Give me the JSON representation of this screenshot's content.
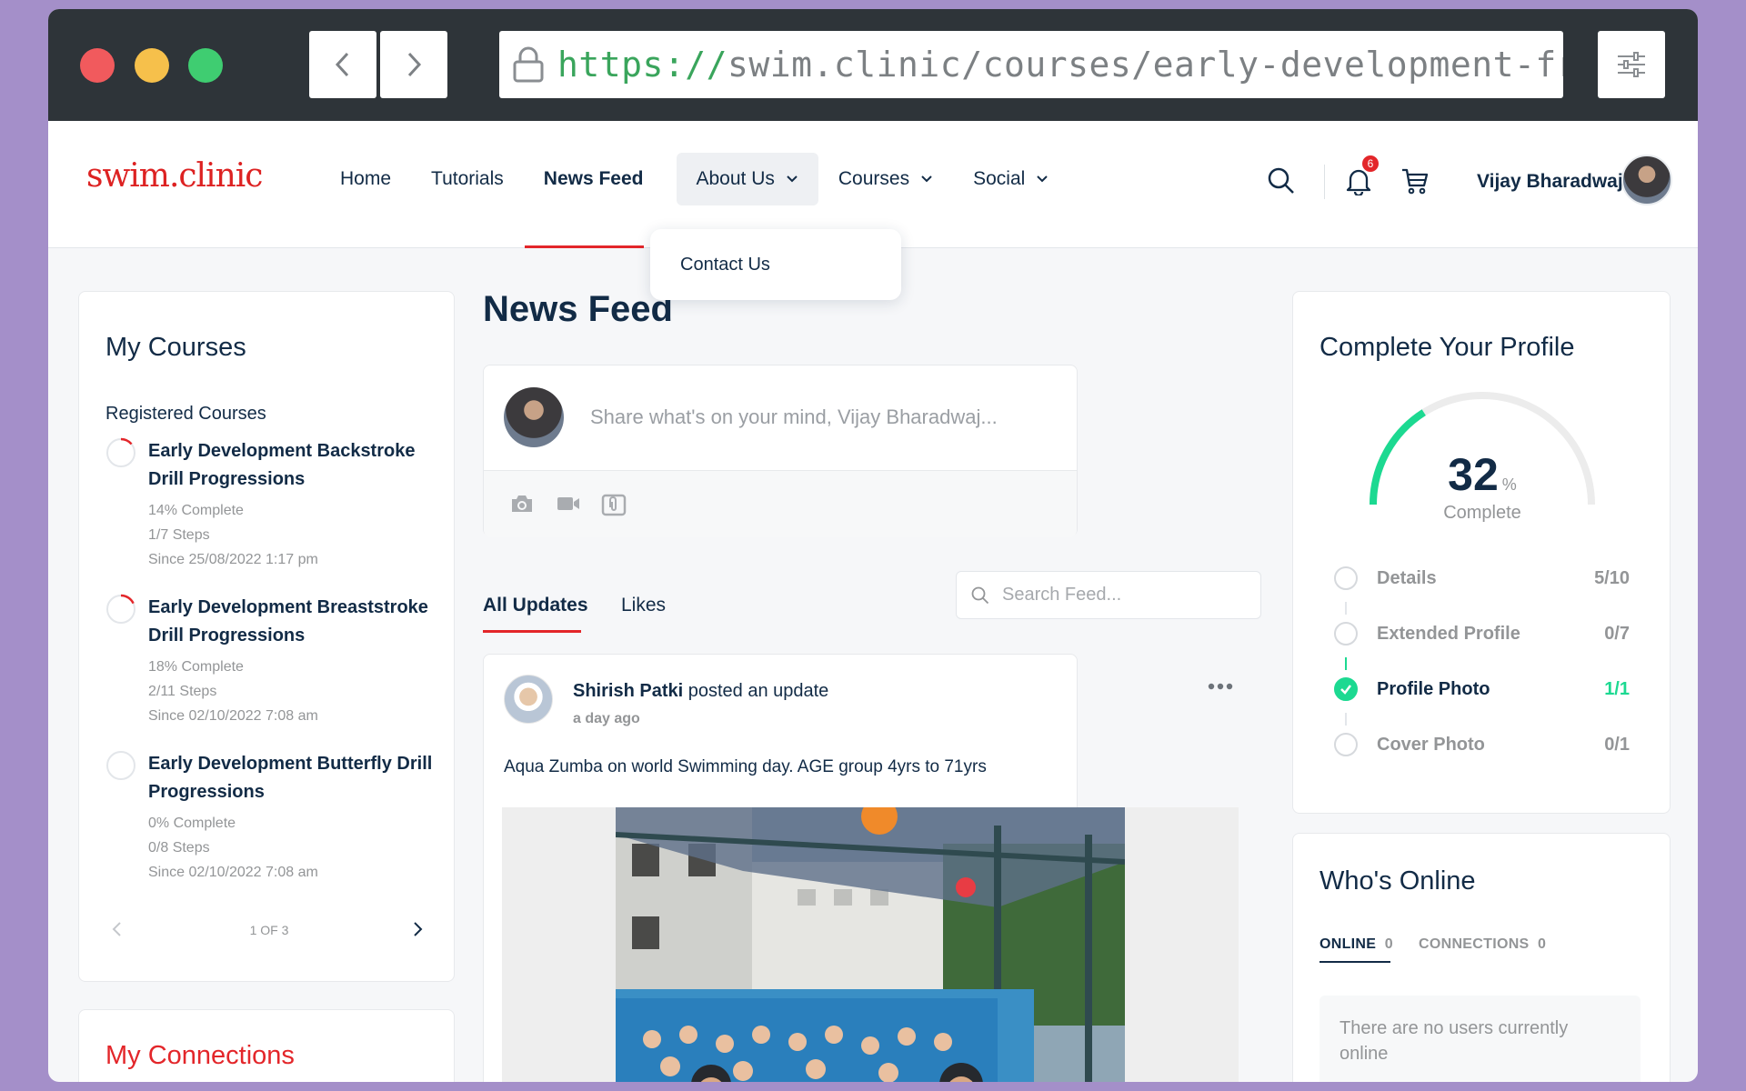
{
  "browser": {
    "url_protocol": "https://",
    "url_rest": "swim.clinic/courses/early-development-fre"
  },
  "site": {
    "logo": "swim.clinic",
    "nav": [
      {
        "label": "Home"
      },
      {
        "label": "Tutorials"
      },
      {
        "label": "News Feed"
      },
      {
        "label": "About Us"
      },
      {
        "label": "Courses"
      },
      {
        "label": "Social"
      }
    ],
    "dropdown_item": "Contact Us",
    "notification_count": "6",
    "user_name": "Vijay Bharadwaj"
  },
  "my_courses": {
    "title": "My Courses",
    "subtitle": "Registered Courses",
    "courses": [
      {
        "name": "Early Development Backstroke Drill Progressions",
        "percent": "14% Complete",
        "steps": "1/7 Steps",
        "since": "Since 25/08/2022 1:17 pm",
        "progress": 0.14
      },
      {
        "name": "Early Development Breaststroke Drill Progressions",
        "percent": "18% Complete",
        "steps": "2/11 Steps",
        "since": "Since 02/10/2022 7:08 am",
        "progress": 0.18
      },
      {
        "name": "Early Development Butterfly Drill Progressions",
        "percent": "0% Complete",
        "steps": "0/8 Steps",
        "since": "Since 02/10/2022 7:08 am",
        "progress": 0
      }
    ],
    "pager": "1 OF 3"
  },
  "my_connections": {
    "title": "My Connections"
  },
  "feed": {
    "title": "News Feed",
    "placeholder": "Share what's on your mind, Vijay Bharadwaj...",
    "tabs": [
      "All Updates",
      "Likes"
    ],
    "search_placeholder": "Search Feed...",
    "post": {
      "author": "Shirish Patki",
      "action": " posted an update",
      "time": "a day ago",
      "text": "Aqua Zumba on world Swimming day. AGE group 4yrs to 71yrs"
    }
  },
  "profile": {
    "title": "Complete Your Profile",
    "percent": "32",
    "percent_sign": "%",
    "complete_label": "Complete",
    "progress": 0.32,
    "items": [
      {
        "label": "Details",
        "value": "5/10",
        "done": false
      },
      {
        "label": "Extended Profile",
        "value": "0/7",
        "done": false
      },
      {
        "label": "Profile Photo",
        "value": "1/1",
        "done": true
      },
      {
        "label": "Cover Photo",
        "value": "0/1",
        "done": false
      }
    ]
  },
  "online": {
    "title": "Who's Online",
    "tab_online": "ONLINE",
    "tab_online_count": "0",
    "tab_connections": "CONNECTIONS",
    "tab_connections_count": "0",
    "empty": "There are no users currently online"
  },
  "colors": {
    "accent": "#e3262a",
    "brand": "#dd2222",
    "success": "#1cd991",
    "text": "#122b46"
  }
}
